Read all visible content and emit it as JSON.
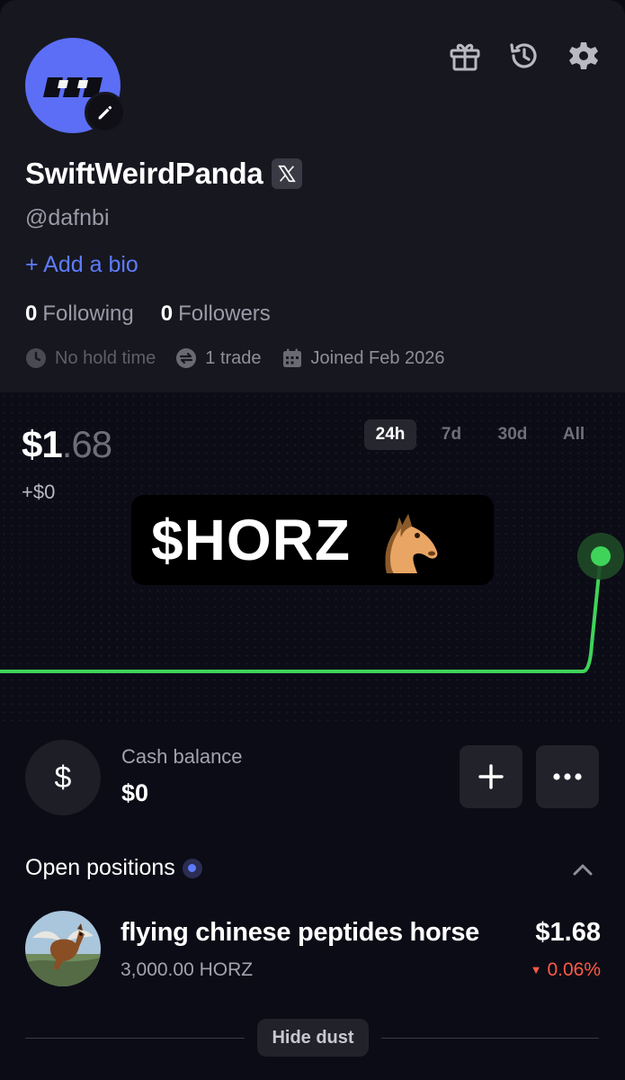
{
  "profile": {
    "username": "SwiftWeirdPanda",
    "handle": "@dafnbi",
    "add_bio": "+ Add a bio",
    "following_count": "0",
    "following_label": "Following",
    "followers_count": "0",
    "followers_label": "Followers",
    "meta": {
      "hold_time": "No hold time",
      "trades": "1 trade",
      "joined": "Joined Feb 2026"
    },
    "avatar_color": "#5b6ef5"
  },
  "header_icons": [
    "gift-icon",
    "history-icon",
    "gear-icon"
  ],
  "portfolio": {
    "value_main": "$1",
    "value_cents": ".68",
    "change": "+$0",
    "ranges": [
      "24h",
      "7d",
      "30d",
      "All"
    ],
    "active_range": "24h",
    "overlay_ticker": "$HORZ"
  },
  "chart_data": {
    "type": "line",
    "series": [
      {
        "values": [
          0,
          0,
          0,
          0,
          0,
          0,
          0,
          0,
          0,
          1.68
        ]
      }
    ],
    "color": "#3fd35a"
  },
  "cash": {
    "label": "Cash balance",
    "value": "$0",
    "icon": "$"
  },
  "positions": {
    "title": "Open positions",
    "items": [
      {
        "name": "flying chinese peptides horse",
        "amount": "3,000.00 HORZ",
        "value": "$1.68",
        "change": "0.06%"
      }
    ]
  },
  "dust": {
    "label": "Hide dust"
  },
  "colors": {
    "accent": "#5d7cff",
    "positive": "#3fd35a",
    "negative": "#ff5a45",
    "background": "#0c0c16"
  }
}
